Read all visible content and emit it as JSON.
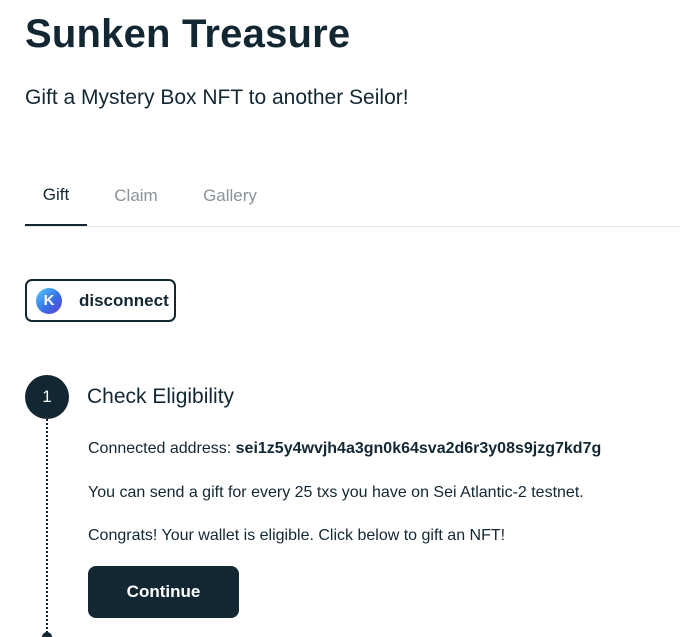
{
  "header": {
    "title": "Sunken Treasure",
    "subtitle": "Gift a Mystery Box NFT to another Seilor!"
  },
  "tabs": [
    {
      "label": "Gift",
      "active": true
    },
    {
      "label": "Claim",
      "active": false
    },
    {
      "label": "Gallery",
      "active": false
    }
  ],
  "wallet": {
    "icon_letter": "K",
    "icon": "keplr-wallet-icon",
    "button_label": "disconnect"
  },
  "step": {
    "number": "1",
    "title": "Check Eligibility",
    "address_label": "Connected address: ",
    "address_value": "sei1z5y4wvjh4a3gn0k64sva2d6r3y08s9jzg7kd7g",
    "send_info": "You can send a gift for every 25 txs you have on Sei Atlantic-2 testnet.",
    "congrats": "Congrats! Your wallet is eligible. Click below to gift an NFT!",
    "continue_label": "Continue"
  },
  "colors": {
    "primary": "#132733",
    "muted_tab": "#8a939a",
    "divider": "#e2e6ea"
  }
}
